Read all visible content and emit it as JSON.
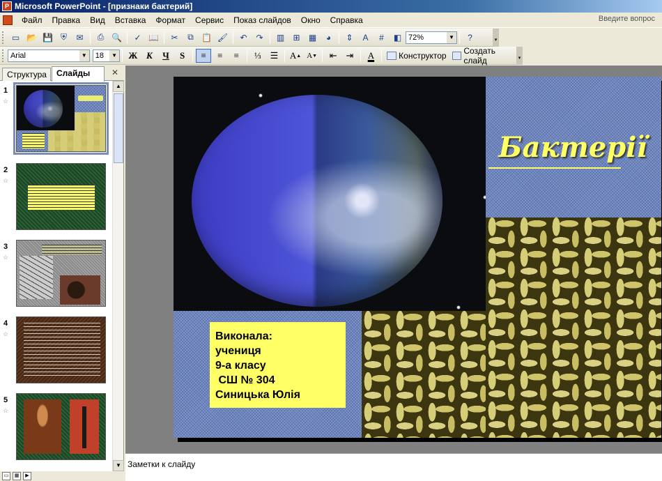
{
  "window": {
    "title": "Microsoft PowerPoint - [признаки бактерий]"
  },
  "menu": {
    "items": [
      {
        "label": "Файл"
      },
      {
        "label": "Правка"
      },
      {
        "label": "Вид"
      },
      {
        "label": "Вставка"
      },
      {
        "label": "Формат"
      },
      {
        "label": "Сервис"
      },
      {
        "label": "Показ слайдов"
      },
      {
        "label": "Окно"
      },
      {
        "label": "Справка"
      }
    ],
    "help_prompt": "Введите вопрос"
  },
  "toolbar": {
    "zoom": "72%",
    "font_name": "Arial",
    "font_size": "18",
    "bold": "Ж",
    "italic": "К",
    "underline": "Ч",
    "shadow": "S",
    "designer_label": "Конструктор",
    "new_slide_label": "Создать слайд"
  },
  "left_pane": {
    "tabs": [
      {
        "label": "Структура"
      },
      {
        "label": "Слайды"
      }
    ],
    "slides": [
      {
        "number": "1"
      },
      {
        "number": "2"
      },
      {
        "number": "3"
      },
      {
        "number": "4"
      },
      {
        "number": "5"
      }
    ]
  },
  "slide": {
    "title": "Бактерії",
    "author_lines": [
      "Виконала:",
      "учениця",
      "9-а класу",
      " СШ № 304",
      "Синицька Юлія"
    ]
  },
  "notes": {
    "placeholder": "Заметки к слайду"
  },
  "colors": {
    "title_text": "#ffff66",
    "author_box": "#ffff66",
    "workspace": "#808080"
  }
}
